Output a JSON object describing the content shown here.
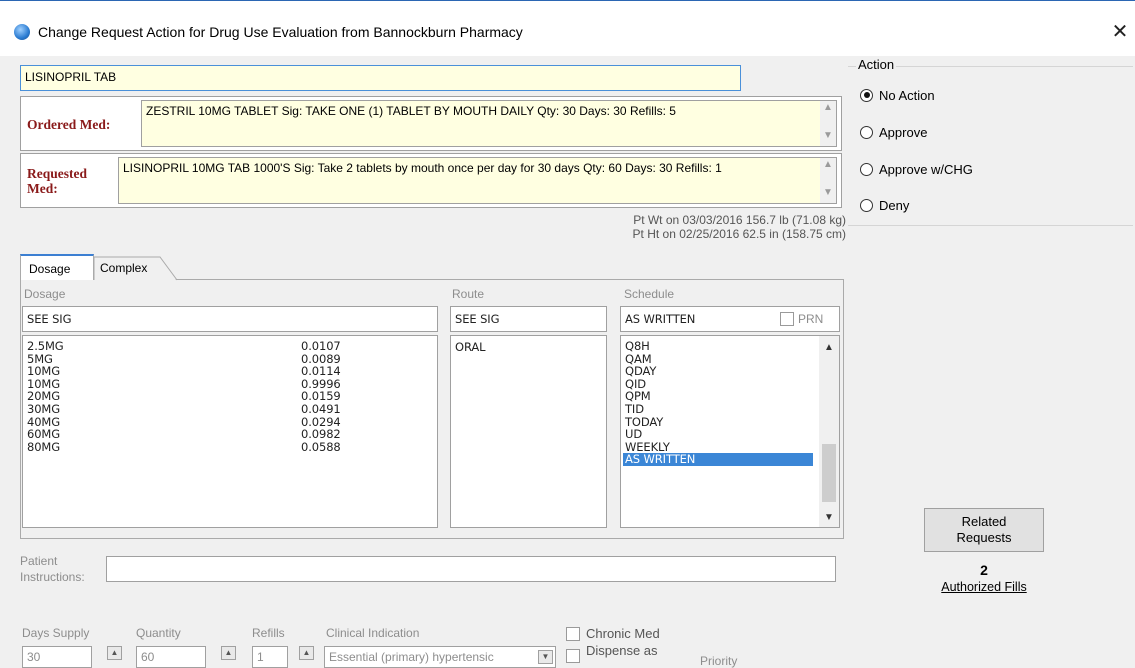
{
  "window": {
    "title": "Change Request Action for Drug Use Evaluation from Bannockburn Pharmacy",
    "close_glyph": "✕"
  },
  "drug_name": "LISINOPRIL TAB",
  "ordered_med": {
    "label": "Ordered Med:",
    "text": "ZESTRIL 10MG TABLET Sig: TAKE ONE (1) TABLET BY MOUTH DAILY Qty: 30 Days: 30 Refills: 5"
  },
  "requested_med": {
    "label_line1": "Requested",
    "label_line2": "Med:",
    "text": "LISINOPRIL 10MG TAB 1000'S Sig: Take 2 tablets by mouth once per day for 30 days Qty: 60 Days: 30 Refills: 1"
  },
  "action": {
    "legend": "Action",
    "options": [
      "No Action",
      "Approve",
      "Approve w/CHG",
      "Deny"
    ],
    "selected": "No Action"
  },
  "patient_info": {
    "weight": "Pt Wt on 03/03/2016 156.7 lb (71.08 kg)",
    "height": "Pt Ht on 02/25/2016 62.5 in (158.75 cm)"
  },
  "tabs": [
    "Dosage",
    "Complex"
  ],
  "dosage": {
    "label": "Dosage",
    "value": "SEE SIG",
    "list": [
      {
        "dose": "2.5MG",
        "value": "0.0107"
      },
      {
        "dose": "5MG",
        "value": "0.0089"
      },
      {
        "dose": "10MG",
        "value": "0.0114"
      },
      {
        "dose": "10MG",
        "value": "0.9996"
      },
      {
        "dose": "20MG",
        "value": "0.0159"
      },
      {
        "dose": "30MG",
        "value": "0.0491"
      },
      {
        "dose": "40MG",
        "value": "0.0294"
      },
      {
        "dose": "60MG",
        "value": "0.0982"
      },
      {
        "dose": "80MG",
        "value": "0.0588"
      }
    ]
  },
  "route": {
    "label": "Route",
    "value": "SEE SIG",
    "list": [
      "ORAL"
    ]
  },
  "schedule": {
    "label": "Schedule",
    "value": "AS WRITTEN",
    "prn_label": "PRN",
    "list": [
      "Q8H",
      "QAM",
      "QDAY",
      "QID",
      "QPM",
      "TID",
      "TODAY",
      "UD",
      "WEEKLY",
      "AS WRITTEN"
    ],
    "selected": "AS WRITTEN"
  },
  "patient_instructions": {
    "label_line1": "Patient",
    "label_line2": "Instructions:",
    "value": ""
  },
  "bottom": {
    "days_supply": {
      "label": "Days Supply",
      "value": "30"
    },
    "quantity": {
      "label": "Quantity",
      "value": "60"
    },
    "refills": {
      "label": "Refills",
      "value": "1"
    },
    "clinical_indication": {
      "label": "Clinical Indication",
      "value": "Essential (primary) hypertensic"
    },
    "chronic_med": "Chronic Med",
    "dispense_as": "Dispense as",
    "priority": "Priority"
  },
  "related": {
    "line1": "Related",
    "line2": "Requests",
    "count": "2",
    "authorized_label": "Authorized Fills"
  },
  "colors": {
    "accent": "#3b86d6",
    "label_red": "#8a1a1a",
    "yellow_bg": "#ffffe1"
  }
}
